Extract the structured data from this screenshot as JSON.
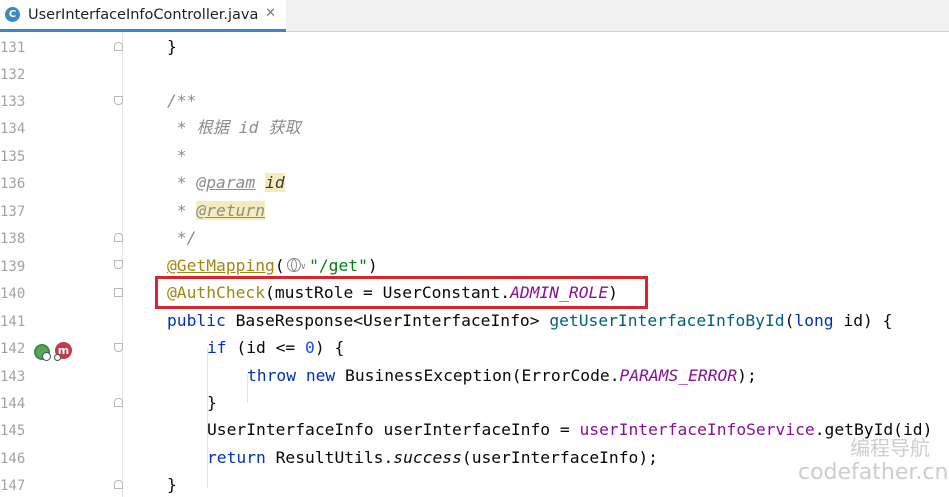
{
  "tab": {
    "icon_letter": "C",
    "title": "UserInterfaceInfoController.java",
    "close": "✕"
  },
  "line_numbers": [
    "131",
    "132",
    "133",
    "134",
    "135",
    "136",
    "137",
    "138",
    "139",
    "140",
    "141",
    "142",
    "143",
    "144",
    "145",
    "146",
    "147"
  ],
  "code": {
    "l131": "}",
    "l133": "/**",
    "l134_star": " * ",
    "l134_text": "根据 id 获取",
    "l135": " *",
    "l136_star": " * ",
    "l136_tag": "@param",
    "l136_sp": " ",
    "l136_param": "id",
    "l137_star": " * ",
    "l137_tag": "@return",
    "l138": " */",
    "l139_ann": "@GetMapping",
    "l139_open": "(",
    "l139_chev": "∨",
    "l139_str": "\"/get\"",
    "l139_close": ")",
    "l140_ann": "@AuthCheck",
    "l140_a": "(mustRole = UserConstant.",
    "l140_const": "ADMIN_ROLE",
    "l140_b": ")",
    "l141_kw": "public",
    "l141_a": " BaseResponse<UserInterfaceInfo> ",
    "l141_method": "getUserInterfaceInfoById",
    "l141_b": "(",
    "l141_kw2": "long",
    "l141_c": " id) {",
    "l142_kw": "if",
    "l142_a": " (id <= ",
    "l142_num": "0",
    "l142_b": ") {",
    "l143_kw": "throw",
    "l143_sp": " ",
    "l143_kw2": "new",
    "l143_a": " BusinessException(ErrorCode.",
    "l143_const": "PARAMS_ERROR",
    "l143_b": ");",
    "l144": "}",
    "l145_a": "UserInterfaceInfo userInterfaceInfo = ",
    "l145_field": "userInterfaceInfoService",
    "l145_b": ".getById(id)",
    "l146_kw": "return",
    "l146_a": " ResultUtils.",
    "l146_static": "success",
    "l146_b": "(userInterfaceInfo);",
    "l147": "}"
  },
  "gutter_icons": {
    "web": "web-endpoint-icon",
    "m": "m"
  },
  "watermark": {
    "line1": "编程导航",
    "line2": "codefather.cn"
  },
  "colors": {
    "keyword": "#0033b3",
    "annotation": "#9e880d",
    "string": "#067d17",
    "number": "#1750eb",
    "constant": "#871094",
    "method": "#00627a",
    "comment": "#8c8c8c",
    "highlight_box": "#d9262d",
    "tab_underline": "#4083c9"
  }
}
